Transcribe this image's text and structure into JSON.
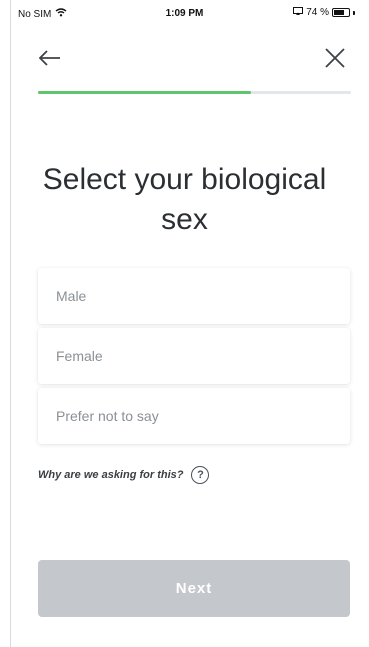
{
  "status_bar": {
    "carrier": "No SIM",
    "time": "1:09 PM",
    "battery": "74 %",
    "battery_level": 0.74,
    "wifi_icon": "wifi-icon",
    "screen_icon": "screen-mirroring-icon",
    "battery_icon": "battery-icon"
  },
  "header": {
    "back_icon": "arrow-left-icon",
    "close_icon": "close-icon",
    "progress": 0.68,
    "progress_color": "#5ec46d"
  },
  "title": "Select your biological sex",
  "options": [
    {
      "label": "Male"
    },
    {
      "label": "Female"
    },
    {
      "label": "Prefer not to say"
    }
  ],
  "help": {
    "text": "Why are we asking for this?",
    "icon": "question-circle-icon",
    "glyph": "?"
  },
  "next_button": {
    "label": "Next",
    "enabled": false,
    "color": "#c4c7cb"
  }
}
